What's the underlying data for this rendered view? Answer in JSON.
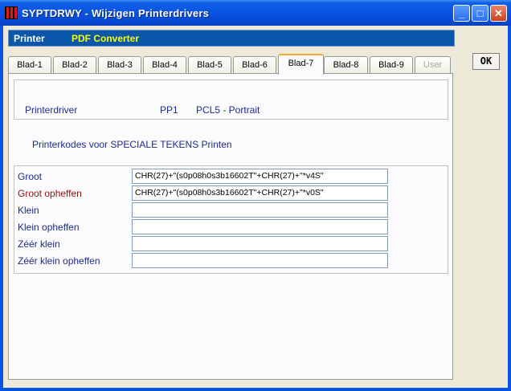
{
  "window": {
    "title": "SYPTDRWY - Wijzigen Printerdrivers",
    "min": "_",
    "max": "□",
    "close": "✕"
  },
  "printer": {
    "label": "Printer",
    "value": "PDF Converter"
  },
  "ok_label": "OK",
  "tabs": [
    {
      "label": "Blad-1",
      "state": "normal"
    },
    {
      "label": "Blad-2",
      "state": "normal"
    },
    {
      "label": "Blad-3",
      "state": "normal"
    },
    {
      "label": "Blad-4",
      "state": "normal"
    },
    {
      "label": "Blad-5",
      "state": "normal"
    },
    {
      "label": "Blad-6",
      "state": "normal"
    },
    {
      "label": "Blad-7",
      "state": "active"
    },
    {
      "label": "Blad-8",
      "state": "normal"
    },
    {
      "label": "Blad-9",
      "state": "normal"
    },
    {
      "label": "User",
      "state": "disabled"
    }
  ],
  "driver": {
    "label": "Printerdriver",
    "code": "PP1",
    "description": "PCL5 - Portrait"
  },
  "section_title": "Printerkodes voor SPECIALE TEKENS Printen",
  "rows": [
    {
      "label": "Groot",
      "value": "CHR(27)+\"(s0p08h0s3b16602T\"+CHR(27)+\"*v4S\""
    },
    {
      "label": "Groot opheffen",
      "value": "CHR(27)+\"(s0p08h0s3b16602T\"+CHR(27)+\"*v0S\""
    },
    {
      "label": "Klein",
      "value": ""
    },
    {
      "label": "Klein opheffen",
      "value": ""
    },
    {
      "label": "Zéér klein",
      "value": ""
    },
    {
      "label": "Zéér klein opheffen",
      "value": ""
    }
  ]
}
